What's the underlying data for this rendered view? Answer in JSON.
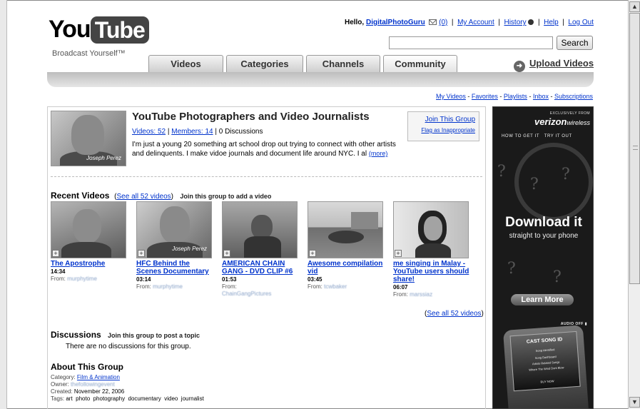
{
  "header": {
    "logo_you": "You",
    "logo_tube": "Tube",
    "tagline": "Broadcast Yourself™",
    "greeting": "Hello,",
    "username": "DigitalPhotoGuru",
    "mail_count": "(0)",
    "links": [
      "My Account",
      "History",
      "Help",
      "Log Out"
    ],
    "search_button": "Search",
    "search_value": ""
  },
  "tabs": [
    "Videos",
    "Categories",
    "Channels",
    "Community"
  ],
  "upload_label": "Upload Videos",
  "sublinks": [
    "My Videos",
    "Favorites",
    "Playlists",
    "Inbox",
    "Subscriptions"
  ],
  "group": {
    "title": "YouTube Photographers and Video Journalists",
    "videos_link": "Videos: 52",
    "members_link": "Members: 14",
    "discussions": "0 Discussions",
    "description": "I'm just a young 20 something art school drop out trying to connect with other artists and delinquents. I make vidoe journals and document life around NYC. I al",
    "more": "(more)",
    "thumb_signature": "Joseph Perez",
    "join_label": "Join This Group",
    "flag_label": "Flag as Inappropriate"
  },
  "recent_videos": {
    "heading": "Recent Videos",
    "see_all": "See all 52 videos",
    "join_prompt": "Join this group to add a video",
    "see_all_bottom": "See all 52 videos",
    "items": [
      {
        "title": "The Apostrophe",
        "duration": "14:34",
        "from_label": "From:",
        "from_user": "murphytime"
      },
      {
        "title": "HFC Behind the Scenes Documentary",
        "duration": "03:14",
        "from_label": "From:",
        "from_user": "murphytime"
      },
      {
        "title": "AMERICAN CHAIN GANG - DVD CLIP #6",
        "duration": "01:53",
        "from_label": "From:",
        "from_user": "ChainGangPictures"
      },
      {
        "title": "Awesome compilation vid",
        "duration": "03:45",
        "from_label": "From:",
        "from_user": "tcwbaker"
      },
      {
        "title": "me singing in Malay - YouTube users should share!",
        "duration": "06:07",
        "from_label": "From:",
        "from_user": "marssiaz"
      }
    ]
  },
  "discussions": {
    "heading": "Discussions",
    "join_prompt": "Join this group to post a topic",
    "empty_text": "There are no discussions for this group."
  },
  "about": {
    "heading": "About This Group",
    "category_label": "Category:",
    "category_value": "Film & Animation",
    "owner_label": "Owner:",
    "owner_value": "thefollowingevent",
    "created_label": "Created:",
    "created_value": "November 22, 2006",
    "tags_label": "Tags:",
    "tags_value": "art  photo  photography  documentary  video  journalist"
  },
  "ad": {
    "exclusive": "EXCLUSIVELY FROM",
    "brand": "verizon",
    "brand_suffix": "wireless",
    "links": "HOW TO GET IT   TRY IT OUT",
    "headline": "Download it",
    "subline": "straight to your phone",
    "button": "Learn More",
    "audio": "AUDIO OFF ▮",
    "screen_title": "CAST SONG ID",
    "screen_lines": [
      "Song Identified",
      "Song Dashboard",
      "Artists Related Songs",
      "Where The Wind Dont Blow",
      "BUY NOW"
    ]
  }
}
